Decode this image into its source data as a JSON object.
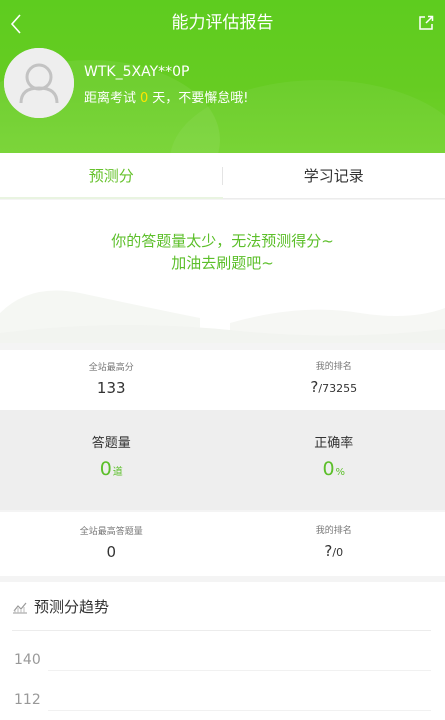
{
  "nav": {
    "title": "能力评估报告"
  },
  "user": {
    "name": "WTK_5XAY**0P",
    "exam_prefix": "距离考试",
    "exam_days": "0",
    "exam_suffix": "天，不要懈怠哦!"
  },
  "tabs": [
    {
      "label": "预测分",
      "active": true
    },
    {
      "label": "学习记录",
      "active": false
    }
  ],
  "prediction": {
    "line1": "你的答题量太少，无法预测得分~",
    "line2": "加油去刷题吧~"
  },
  "stats": {
    "row1": {
      "left": {
        "label": "全站最高分",
        "value": "133"
      },
      "right": {
        "label": "我的排名",
        "value_main": "?",
        "value_sub": "/73255"
      }
    },
    "row2": {
      "left": {
        "label": "答题量",
        "value": "0",
        "unit": "道"
      },
      "right": {
        "label": "正确率",
        "value": "0",
        "unit": "%"
      }
    },
    "row3": {
      "left": {
        "label": "全站最高答题量",
        "value": "0"
      },
      "right": {
        "label": "我的排名",
        "value_main": "?",
        "value_sub": "/0"
      }
    }
  },
  "trend": {
    "title": "预测分趋势",
    "y_ticks": [
      "140",
      "112"
    ]
  },
  "colors": {
    "brand_green": "#66c22c",
    "header_green": "#5ecc1f",
    "highlight_yellow": "#ffe600"
  },
  "icons": {
    "back": "chevron-left-icon",
    "share": "share-icon",
    "avatar": "user-avatar-icon",
    "trend": "chart-icon"
  }
}
